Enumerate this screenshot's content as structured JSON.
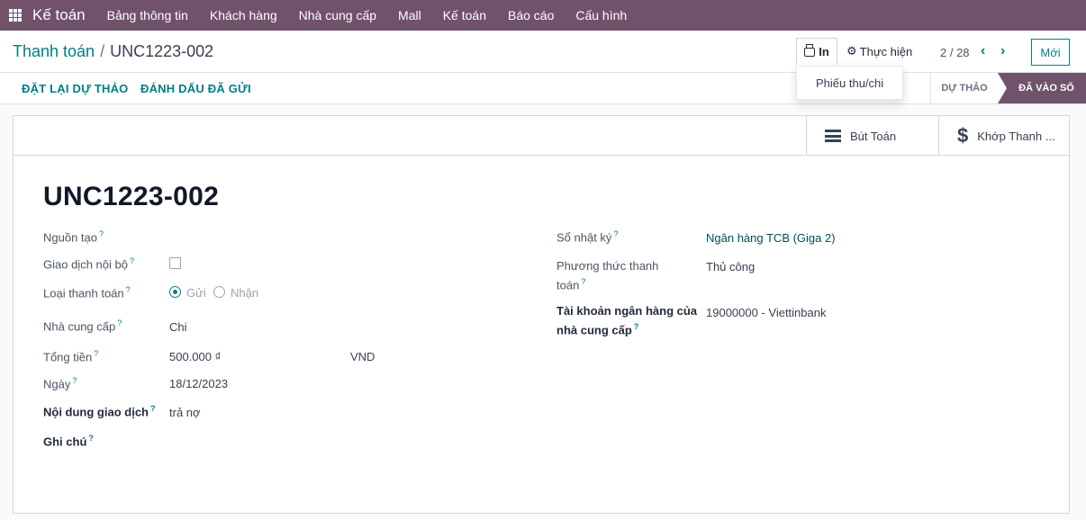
{
  "navbar": {
    "brand": "Kế toán",
    "menu": [
      "Bảng thông tin",
      "Khách hàng",
      "Nhà cung cấp",
      "Mall",
      "Kế toán",
      "Báo cáo",
      "Cấu hình"
    ]
  },
  "breadcrumb": {
    "parent": "Thanh toán",
    "separator": "/",
    "current": "UNC1223-002"
  },
  "toolbar": {
    "print_label": "In",
    "action_label": "Thực hiện",
    "pager": "2 / 28",
    "new_label": "Mới"
  },
  "print_menu": {
    "items": [
      "Phiếu thu/chi"
    ]
  },
  "statusbar": {
    "reset_label": "ĐẶT LẠI DỰ THẢO",
    "mark_sent_label": "ĐÁNH DẤU ĐÃ GỬI",
    "stages": [
      "DỰ THẢO",
      "ĐÃ VÀO SỔ"
    ],
    "active_stage": "ĐÃ VÀO SỔ"
  },
  "smart_buttons": {
    "journal_entries": "Bút Toán",
    "reconcile": "Khớp Thanh ..."
  },
  "record": {
    "title": "UNC1223-002",
    "left": {
      "source_label": "Nguồn tạo",
      "internal_label": "Giao dịch nội bộ",
      "internal_checked": false,
      "payment_type_label": "Loại thanh toán",
      "payment_type_options": [
        "Gửi",
        "Nhận"
      ],
      "payment_type_selected": "Gửi",
      "vendor_label": "Nhà cung cấp",
      "vendor_value": "Chi",
      "amount_label": "Tổng tiền",
      "amount_value": "500.000 ₫",
      "currency_value": "VND",
      "date_label": "Ngày",
      "date_value": "18/12/2023",
      "memo_label": "Nội dung giao dịch",
      "memo_value": "trả nợ",
      "note_label": "Ghi chú"
    },
    "right": {
      "journal_label": "Sổ nhật ký",
      "journal_value": "Ngân hàng TCB (Giga 2)",
      "method_label_1": "Phương thức thanh",
      "method_label_2": "toán",
      "method_value": "Thủ công",
      "bank_label_1": "Tài khoản ngân hàng của",
      "bank_label_2": "nhà cung cấp",
      "bank_value": "19000000 - Viettinbank"
    },
    "help_mark": "?"
  },
  "colors": {
    "brand": "#71526b",
    "accent": "#017e84"
  }
}
